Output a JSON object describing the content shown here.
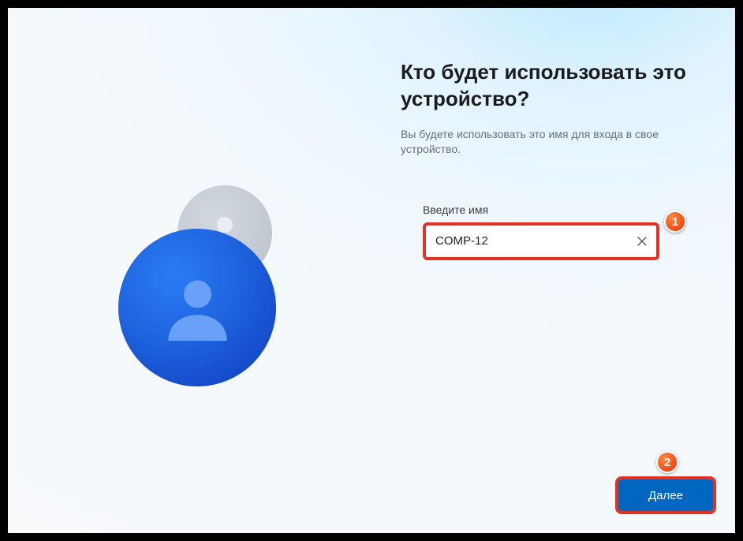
{
  "heading": "Кто будет использовать это устройство?",
  "subheading": "Вы будете использовать это имя для входа в свое устройство.",
  "field": {
    "label": "Введите имя",
    "value": "COMP-12"
  },
  "buttons": {
    "next": "Далее"
  },
  "annotations": {
    "b1": "1",
    "b2": "2"
  }
}
